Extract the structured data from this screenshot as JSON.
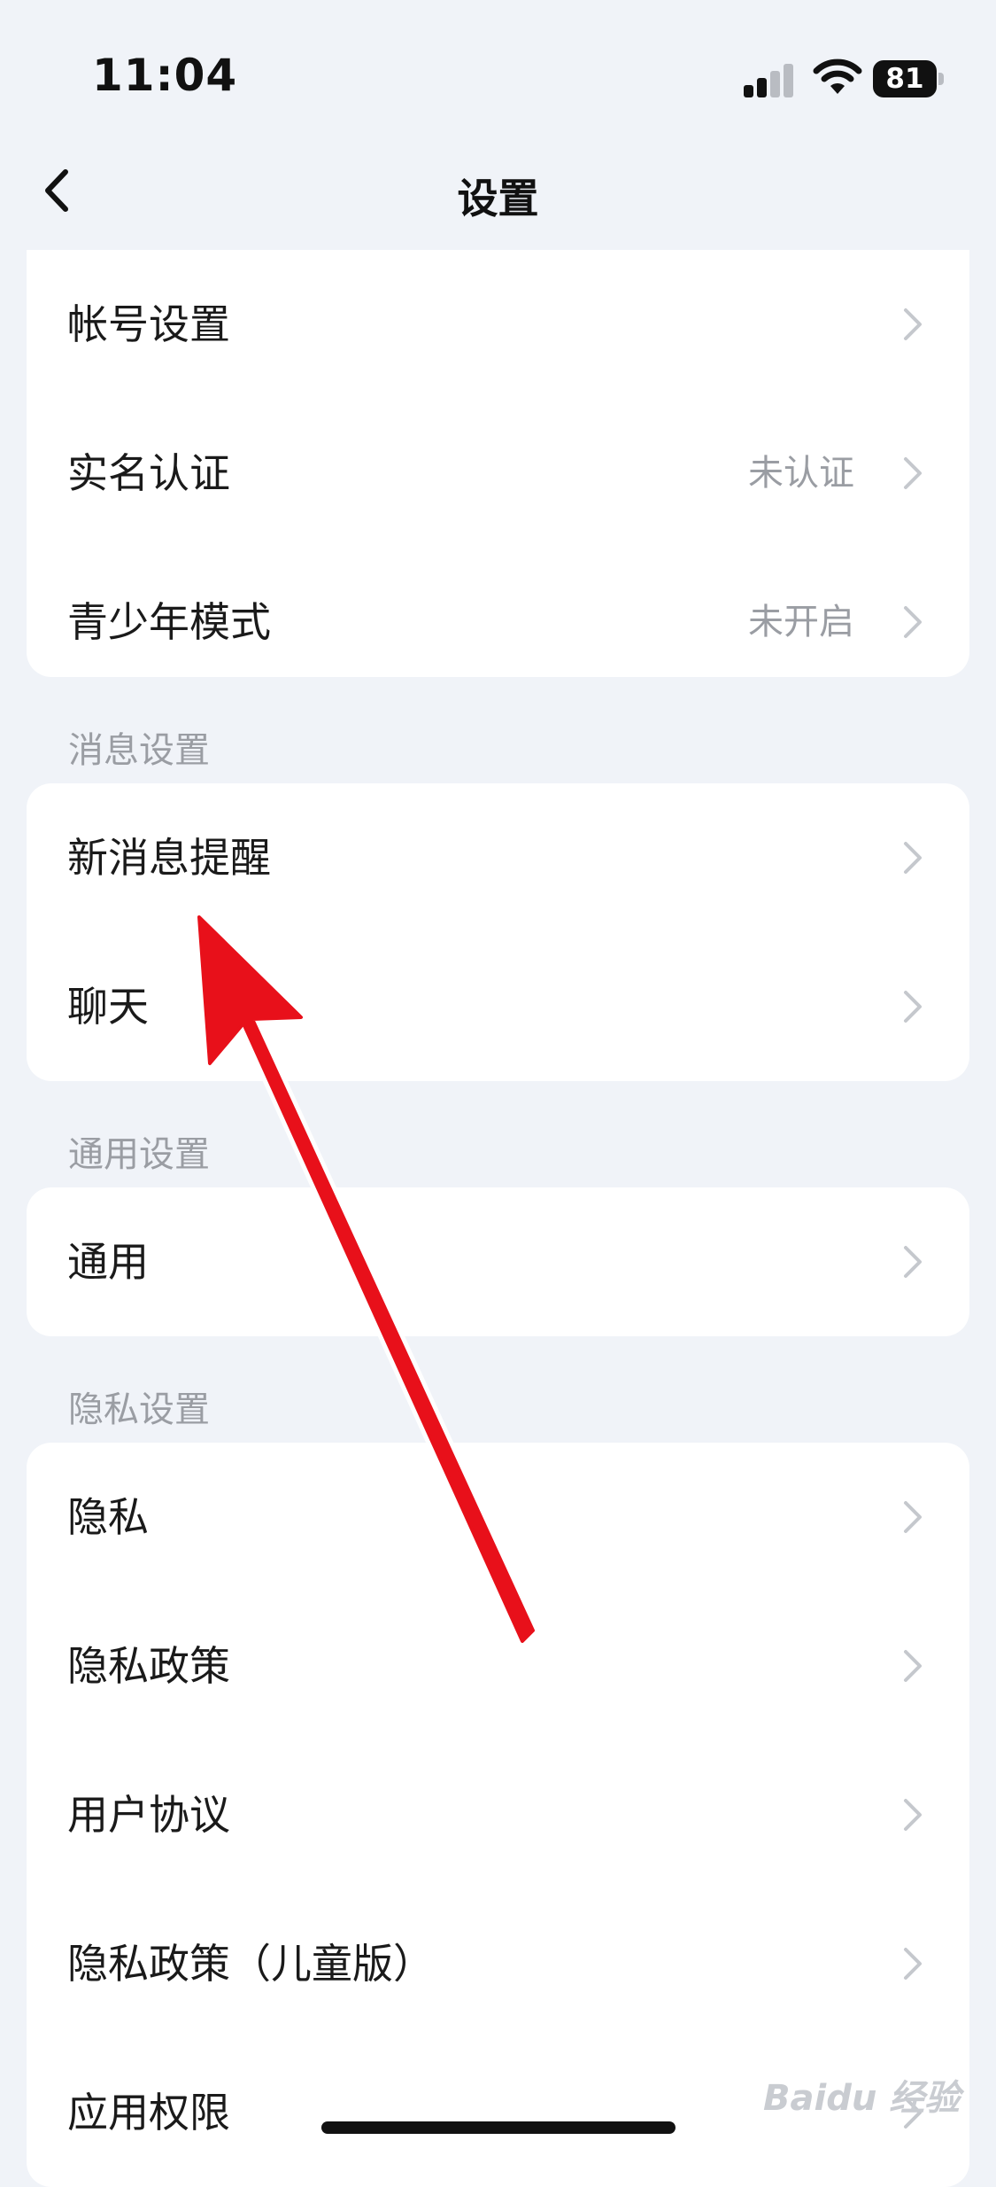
{
  "status_bar": {
    "time": "11:04",
    "battery": "81"
  },
  "nav": {
    "title": "设置"
  },
  "groups": {
    "account": {
      "items": [
        {
          "label": "帐号设置",
          "value": ""
        },
        {
          "label": "实名认证",
          "value": "未认证"
        },
        {
          "label": "青少年模式",
          "value": "未开启"
        }
      ]
    },
    "message": {
      "title": "消息设置",
      "items": [
        {
          "label": "新消息提醒"
        },
        {
          "label": "聊天"
        }
      ]
    },
    "general": {
      "title": "通用设置",
      "items": [
        {
          "label": "通用"
        }
      ]
    },
    "privacy": {
      "title": "隐私设置",
      "items": [
        {
          "label": "隐私"
        },
        {
          "label": "隐私政策"
        },
        {
          "label": "用户协议"
        },
        {
          "label": "隐私政策（儿童版）"
        },
        {
          "label": "应用权限"
        }
      ]
    }
  },
  "watermark": "Baidu 经验",
  "colors": {
    "background": "#f0f3f8",
    "card": "#ffffff",
    "annotation_arrow": "#e8101a",
    "secondary_text": "#9a9da3"
  }
}
